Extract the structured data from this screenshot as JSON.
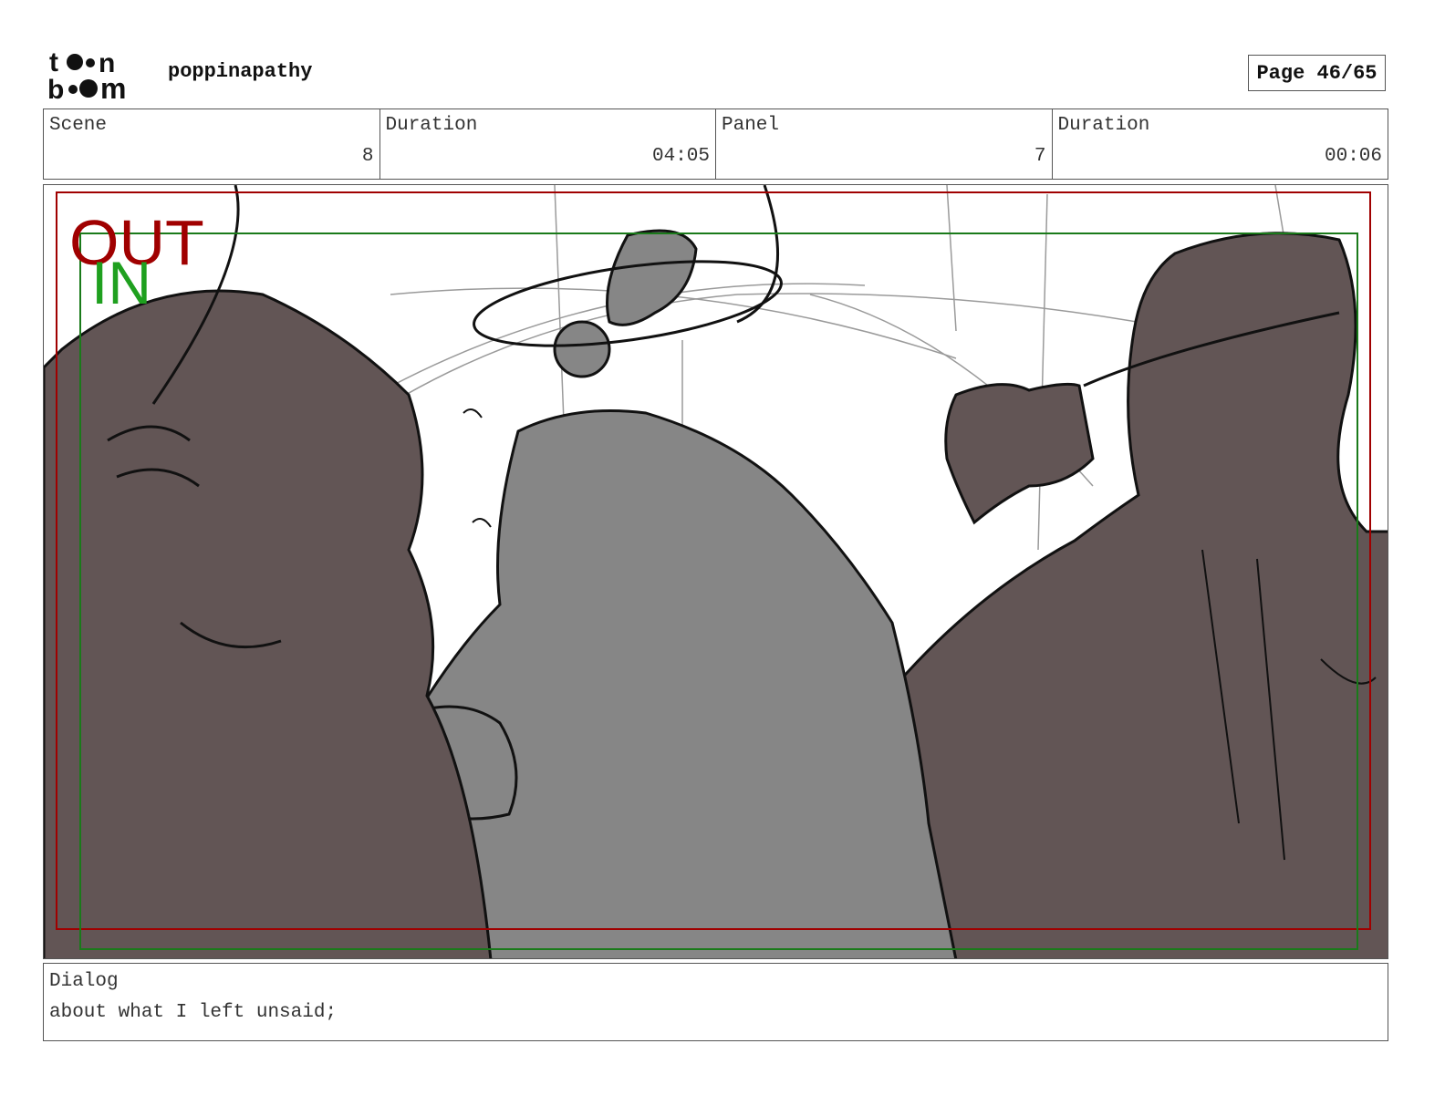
{
  "header": {
    "logo_text": "toon boom",
    "project": "poppinapathy",
    "page": "Page 46/65"
  },
  "info": {
    "scene_label": "Scene",
    "scene_value": "8",
    "scene_duration_label": "Duration",
    "scene_duration_value": "04:05",
    "panel_label": "Panel",
    "panel_value": "7",
    "panel_duration_label": "Duration",
    "panel_duration_value": "00:06"
  },
  "panel": {
    "frame_out_label": "OUT",
    "frame_in_label": "IN",
    "colors": {
      "out_frame": "#a00000",
      "in_frame": "#1a7a1a",
      "dark_fill": "#625555",
      "grey_fill": "#868686"
    }
  },
  "dialog": {
    "label": "Dialog",
    "text": "about what I left unsaid;"
  }
}
